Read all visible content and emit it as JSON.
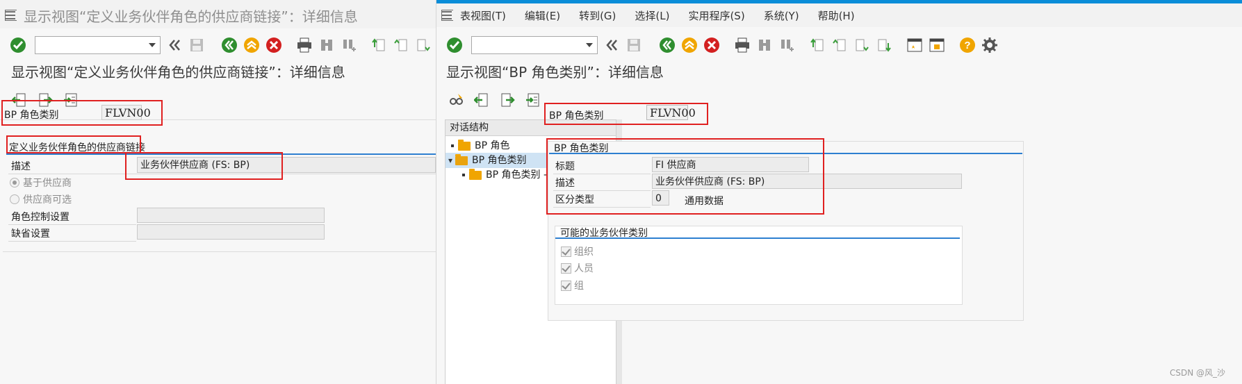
{
  "left": {
    "window_title": "显示视图“定义业务伙伴角色的供应商链接”：详细信息",
    "screen_title": "显示视图“定义业务伙伴角色的供应商链接”：详细信息",
    "bp_role_category_label": "BP 角色类别",
    "bp_role_category_value": "FLVN00",
    "group_title": "定义业务伙伴角色的供应商链接",
    "description_label": "描述",
    "description_value": "业务伙伴供应商 (FS: BP)",
    "radio_vendor_based": "基于供应商",
    "radio_vendor_optional": "供应商可选",
    "role_control_label": "角色控制设置",
    "default_settings_label": "缺省设置"
  },
  "right": {
    "menu": [
      "表视图(T)",
      "编辑(E)",
      "转到(G)",
      "选择(L)",
      "实用程序(S)",
      "系统(Y)",
      "帮助(H)"
    ],
    "screen_title": "显示视图“BP 角色类别”：详细信息",
    "tree": {
      "header": "对话结构",
      "items": [
        "BP 角色",
        "BP 角色类别",
        "BP 角色类别 --> 业务交易"
      ]
    },
    "bp_role_category_label": "BP 角色类别",
    "bp_role_category_value": "FLVN00",
    "group_title": "BP 角色类别",
    "title_label": "标题",
    "title_value": "FI 供应商",
    "description_label": "描述",
    "description_value": "业务伙伴供应商 (FS: BP)",
    "diff_type_label": "区分类型",
    "diff_type_value": "0",
    "diff_type_text": "通用数据",
    "possible_types_title": "可能的业务伙伴类别",
    "checkboxes": [
      "组织",
      "人员",
      "组"
    ]
  },
  "watermark": "CSDN @风_沙",
  "colors": {
    "title_bar_accent": "#0a8dd8",
    "highlight_box": "#e02020",
    "group_rule": "#2d7fd0",
    "selected_tree_row": "#cfe3f4"
  }
}
